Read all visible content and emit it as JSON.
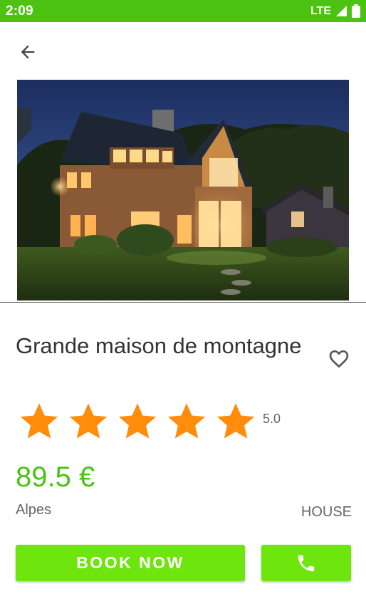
{
  "status_bar": {
    "time": "2:09",
    "network": "LTE",
    "color": "#4cc312"
  },
  "header": {
    "back_icon": "arrow-left-icon"
  },
  "listing": {
    "image_icon": "house-photo",
    "title": "Grande maison de montagne",
    "favorite_icon": "heart-outline-icon",
    "rating": {
      "stars": 5,
      "max_stars": 5,
      "value_label": "5.0",
      "star_color": "#ff8c0a"
    },
    "price": "89.5 €",
    "price_color": "#4cc312",
    "location": "Alpes",
    "type": "HOUSE"
  },
  "actions": {
    "book_label": "BOOK NOW",
    "call_icon": "phone-icon",
    "button_color": "#6ee60e"
  }
}
